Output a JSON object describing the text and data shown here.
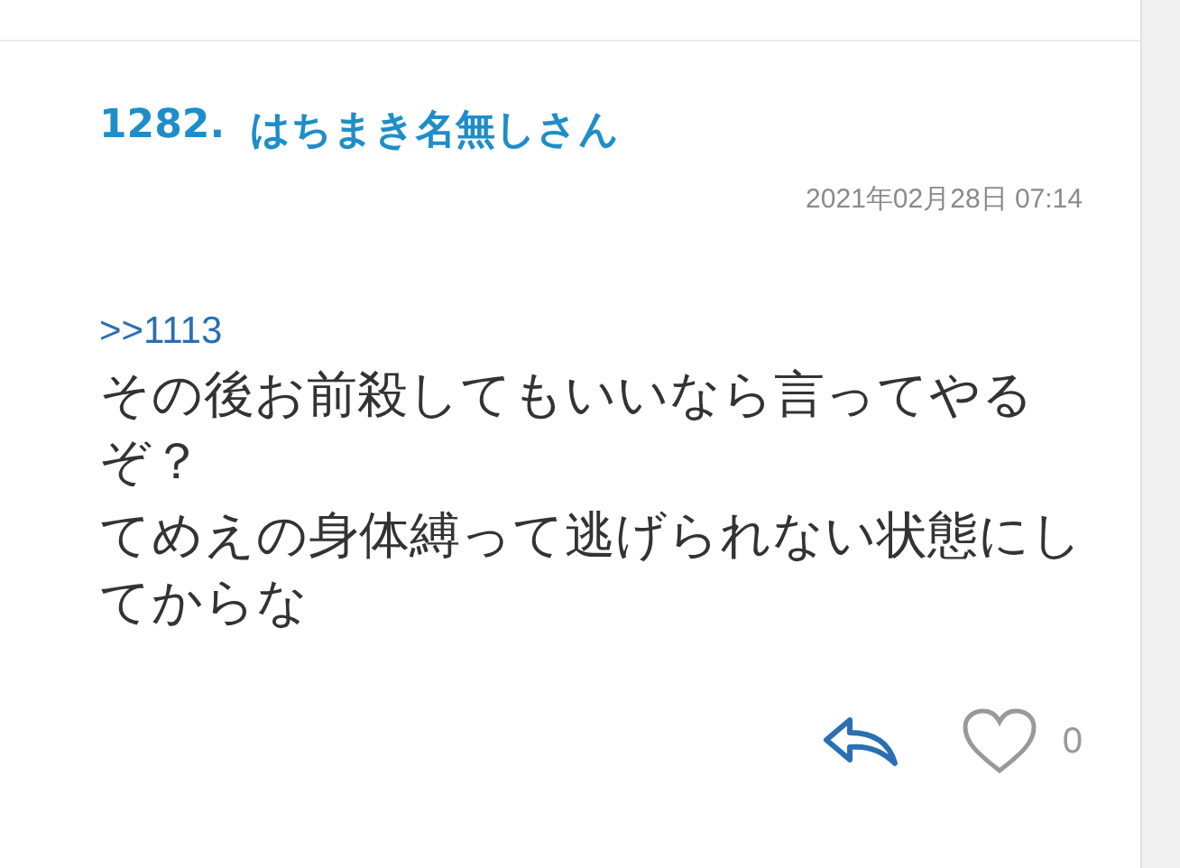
{
  "post": {
    "number": "1282.",
    "author": "はちまき名無しさん",
    "date": "2021年02月28日 07:14",
    "reply_to": ">>1113",
    "body": [
      "その後お前殺してもいいなら言ってやるぞ？",
      "てめえの身体縛って逃げられない状態にしてからな"
    ],
    "likes": "0"
  }
}
